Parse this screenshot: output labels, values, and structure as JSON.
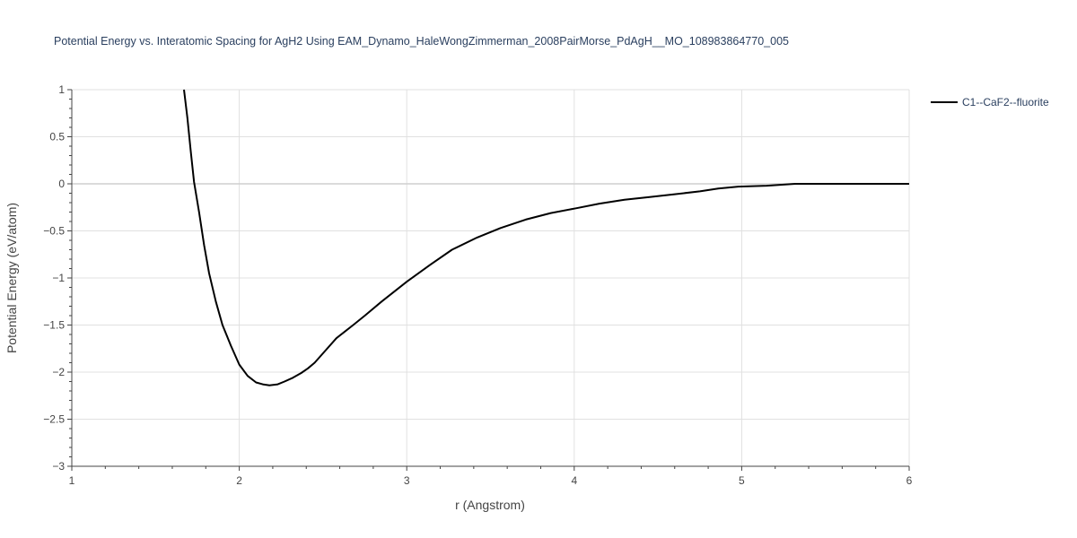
{
  "chart_data": {
    "type": "line",
    "title": "Potential Energy vs. Interatomic Spacing for AgH2 Using EAM_Dynamo_HaleWongZimmerman_2008PairMorse_PdAgH__MO_108983864770_005",
    "xlabel": "r (Angstrom)",
    "ylabel": "Potential Energy (eV/atom)",
    "xlim": [
      1,
      6
    ],
    "ylim": [
      -3,
      1
    ],
    "xticks": [
      1,
      2,
      3,
      4,
      5,
      6
    ],
    "xtick_labels": [
      "1",
      "2",
      "3",
      "4",
      "5",
      "6"
    ],
    "yticks": [
      1,
      0.5,
      0,
      -0.5,
      -1,
      -1.5,
      -2,
      -2.5,
      -3
    ],
    "ytick_labels": [
      "1",
      "0.5",
      "0",
      "−0.5",
      "−1",
      "−1.5",
      "−2",
      "−2.5",
      "−3"
    ],
    "grid": true,
    "legend_position": "top-right",
    "series": [
      {
        "name": "C1--CaF2--fluorite",
        "color": "#000000",
        "x": [
          1.67,
          1.69,
          1.71,
          1.73,
          1.76,
          1.79,
          1.82,
          1.86,
          1.9,
          1.95,
          2.0,
          2.05,
          2.1,
          2.14,
          2.18,
          2.23,
          2.27,
          2.32,
          2.37,
          2.41,
          2.45,
          2.5,
          2.58,
          2.68,
          2.75,
          2.85,
          3.0,
          3.14,
          3.27,
          3.42,
          3.56,
          3.71,
          3.86,
          4.01,
          4.15,
          4.3,
          4.45,
          4.6,
          4.75,
          4.86,
          4.98,
          5.15,
          5.32,
          5.5,
          5.75,
          6.0
        ],
        "y": [
          1.0,
          0.7,
          0.35,
          0.02,
          -0.3,
          -0.65,
          -0.95,
          -1.25,
          -1.5,
          -1.72,
          -1.92,
          -2.04,
          -2.11,
          -2.13,
          -2.14,
          -2.13,
          -2.1,
          -2.06,
          -2.01,
          -1.96,
          -1.9,
          -1.8,
          -1.64,
          -1.5,
          -1.4,
          -1.25,
          -1.04,
          -0.86,
          -0.7,
          -0.57,
          -0.47,
          -0.38,
          -0.31,
          -0.26,
          -0.21,
          -0.17,
          -0.14,
          -0.11,
          -0.08,
          -0.05,
          -0.03,
          -0.02,
          0.0,
          0.0,
          0.0,
          0.0
        ]
      }
    ]
  }
}
